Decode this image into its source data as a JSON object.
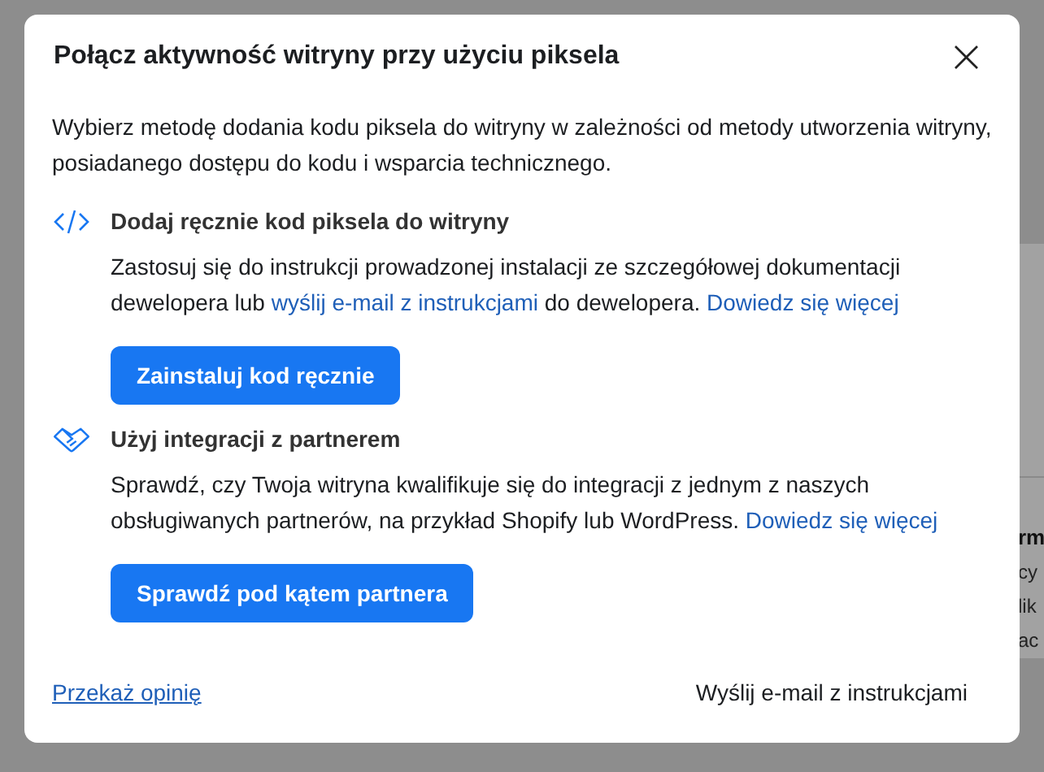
{
  "background": {
    "heading": "rm",
    "lines": [
      "cy",
      "lik",
      "ac"
    ]
  },
  "dialog": {
    "title": "Połącz aktywność witryny przy użyciu piksela",
    "close_label": "×",
    "intro": "Wybierz metodę dodania kodu piksela do witryny w zależności od metody utworzenia witryny, posiadanego dostępu do kodu i wsparcia technicznego.",
    "options": [
      {
        "kind": "code",
        "title": "Dodaj ręcznie kod piksela do witryny",
        "parts": [
          {
            "text": "Zastosuj się do instrukcji prowadzonej instalacji ze szczegółowej dokumentacji dewelopera lub ",
            "link": false
          },
          {
            "text": "wyślij e-mail z instrukcjami",
            "link": true
          },
          {
            "text": " do dewelopera. ",
            "link": false
          },
          {
            "text": "Dowiedz się więcej",
            "link": true
          }
        ],
        "button": "Zainstaluj kod ręcznie"
      },
      {
        "kind": "partner",
        "title": "Użyj integracji z partnerem",
        "parts": [
          {
            "text": "Sprawdź, czy Twoja witryna kwalifikuje się do integracji z jednym z naszych obsługiwanych partnerów, na przykład Shopify lub WordPress. ",
            "link": false
          },
          {
            "text": "Dowiedz się więcej",
            "link": true
          }
        ],
        "button": "Sprawdź pod kątem partnera"
      }
    ],
    "feedback_link": "Przekaż opinię",
    "email_button": "Wyślij e-mail z instrukcjami"
  }
}
